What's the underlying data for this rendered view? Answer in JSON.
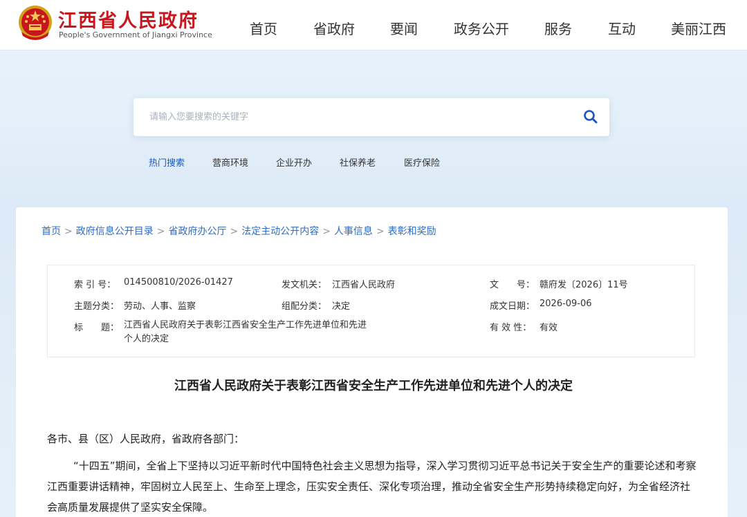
{
  "header": {
    "logo_cn": "江西省人民政府",
    "logo_en": "People's Government of Jiangxi Province",
    "nav": [
      "首页",
      "省政府",
      "要闻",
      "政务公开",
      "服务",
      "互动",
      "美丽江西"
    ]
  },
  "search": {
    "placeholder": "请输入您要搜索的关键字",
    "hot_label": "热门搜索",
    "hot_items": [
      "营商环境",
      "企业开办",
      "社保养老",
      "医疗保险"
    ]
  },
  "breadcrumb": {
    "items": [
      "首页",
      "政府信息公开目录",
      "省政府办公厅",
      "法定主动公开内容",
      "人事信息"
    ],
    "current": "表彰和奖励",
    "separator": ">"
  },
  "meta": {
    "index_label": "索 引 号：",
    "index_value": "014500810/2026-01427",
    "issuer_label": "发文机关：",
    "issuer_value": "江西省人民政府",
    "docno_label": "文　　号：",
    "docno_value": "赣府发〔2026〕11号",
    "topic_label": "主题分类：",
    "topic_value": "劳动、人事、监察",
    "genre_label": "组配分类：",
    "genre_value": "决定",
    "date_label": "成文日期：",
    "date_value": "2026-09-06",
    "title_label": "标　　题：",
    "title_value": "江西省人民政府关于表彰江西省安全生产工作先进单位和先进个人的决定",
    "valid_label": "有 效 性：",
    "valid_value": "有效"
  },
  "document": {
    "title": "江西省人民政府关于表彰江西省安全生产工作先进单位和先进个人的决定",
    "salutation": "各市、县（区）人民政府，省政府各部门：",
    "paragraph1": "“十四五”期间，全省上下坚持以习近平新时代中国特色社会主义思想为指导，深入学习贯彻习近平总书记关于安全生产的重要论述和考察江西重要讲话精神，牢固树立人民至上、生命至上理念，压实安全责任、深化专项治理，推动全省安全生产形势持续稳定向好，为全省经济社会高质量发展提供了坚实安全保障。"
  },
  "colors": {
    "brand_red": "#c8161d",
    "link_blue": "#2e6bc6",
    "hot_blue": "#1a56c2"
  },
  "icons": {
    "search": "search-icon",
    "emblem": "national-emblem-icon"
  }
}
